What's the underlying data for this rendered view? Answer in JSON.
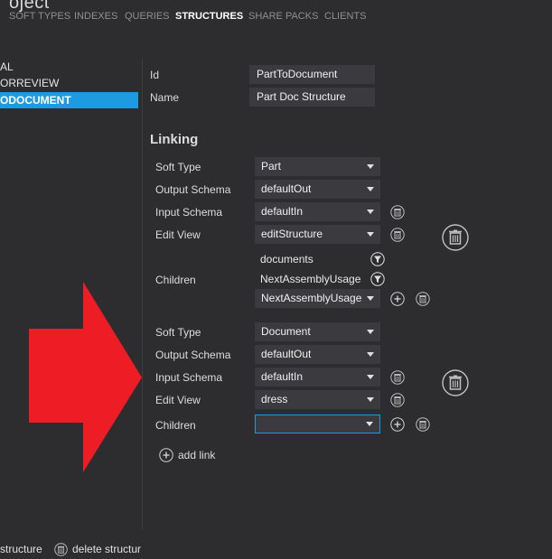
{
  "header": {
    "title_fragment": "oject",
    "tabs": [
      {
        "label": "SOFT TYPES"
      },
      {
        "label": "INDEXES"
      },
      {
        "label": "QUERIES"
      },
      {
        "label": "STRUCTURES"
      },
      {
        "label": "SHARE PACKS"
      },
      {
        "label": "CLIENTS"
      }
    ],
    "active_tab": "STRUCTURES"
  },
  "sidebar": {
    "items": [
      {
        "label": "AL"
      },
      {
        "label": "ORREVIEW"
      },
      {
        "label": "ODOCUMENT"
      }
    ],
    "selected_index": 2
  },
  "form": {
    "id_label": "Id",
    "id_value": "PartToDocument",
    "name_label": "Name",
    "name_value": "Part Doc Structure",
    "linking_heading": "Linking"
  },
  "links": [
    {
      "soft_type_label": "Soft Type",
      "soft_type": "Part",
      "output_schema_label": "Output Schema",
      "output_schema": "defaultOut",
      "input_schema_label": "Input Schema",
      "input_schema": "defaultIn",
      "edit_view_label": "Edit View",
      "edit_view": "editStructure",
      "children_label": "Children",
      "children": [
        "documents",
        "NextAssemblyUsages",
        "NextAssemblyUsage"
      ]
    },
    {
      "soft_type_label": "Soft Type",
      "soft_type": "Document",
      "output_schema_label": "Output Schema",
      "output_schema": "defaultOut",
      "input_schema_label": "Input Schema",
      "input_schema": "defaultIn",
      "edit_view_label": "Edit View",
      "edit_view": "dress",
      "children_label": "Children",
      "children_value": ""
    }
  ],
  "add_link_label": "add link",
  "footer": {
    "new_structure_label": "structure",
    "delete_structure_label": "delete structur"
  },
  "colors": {
    "background": "#2d2d30",
    "accent": "#1e9ae0",
    "arrow": "#ee1c25"
  },
  "icons": {
    "trash": "trash-icon",
    "plus": "plus-circle-icon",
    "filter": "filter-icon",
    "dropdown": "chevron-down-icon"
  }
}
